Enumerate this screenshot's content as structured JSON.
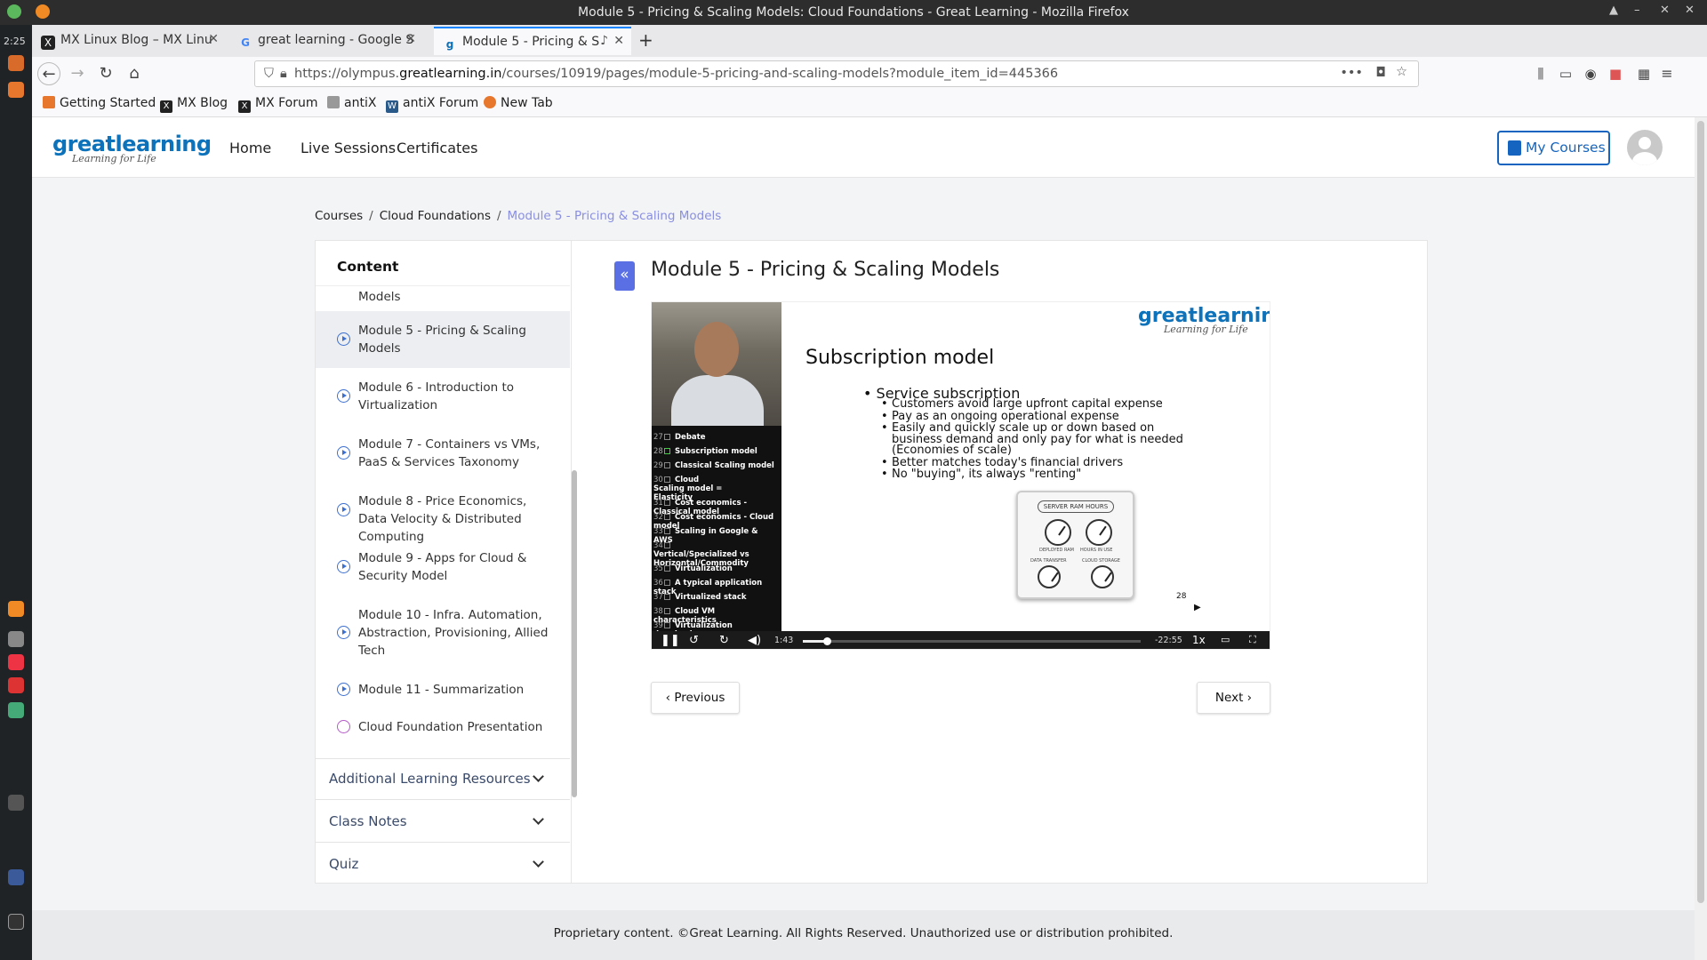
{
  "window": {
    "title": "Module 5 - Pricing & Scaling Models: Cloud Foundations - Great Learning - Mozilla Firefox"
  },
  "desktop": {
    "clock": "2:25"
  },
  "tabs": [
    {
      "label": "MX Linux Blog – MX Linu",
      "icon": "x-logo-icon"
    },
    {
      "label": "great learning - Google S",
      "icon": "google-icon"
    },
    {
      "label": "Module 5 - Pricing & S",
      "icon": "gl-icon",
      "active": true
    }
  ],
  "url": {
    "prefix": "https://olympus.",
    "domain": "greatlearning.in",
    "path": "/courses/10919/pages/module-5-pricing-and-scaling-models?module_item_id=445366"
  },
  "bookmarks": [
    "Getting Started",
    "MX Blog",
    "MX Forum",
    "antiX",
    "antiX Forum",
    "New Tab"
  ],
  "site": {
    "logo_main": "greatlearning",
    "logo_tag": "Learning for Life",
    "nav": [
      "Home",
      "Live Sessions",
      "Certificates"
    ],
    "my_courses": "My Courses"
  },
  "breadcrumb": [
    "Courses",
    "Cloud Foundations",
    "Module 5 - Pricing & Scaling Models"
  ],
  "sidebar": {
    "title": "Content",
    "items": [
      {
        "label": "Models"
      },
      {
        "label": "Module 5 - Pricing & Scaling Models",
        "active": true
      },
      {
        "label": "Module 6 - Introduction to Virtualization"
      },
      {
        "label": "Module 7 - Containers vs VMs, PaaS & Services Taxonomy"
      },
      {
        "label": "Module 8 - Price Economics, Data Velocity & Distributed Computing"
      },
      {
        "label": "Module 9 - Apps for Cloud & Security Model"
      },
      {
        "label": "Module 10 - Infra. Automation, Abstraction, Provisioning, Allied Tech"
      },
      {
        "label": "Module 11 - Summarization"
      },
      {
        "label": "Cloud Foundation Presentation"
      }
    ],
    "sections": [
      "Additional Learning Resources",
      "Class Notes",
      "Quiz"
    ]
  },
  "content": {
    "title": "Module 5 - Pricing & Scaling Models",
    "slide": {
      "logo_main": "greatlearning",
      "logo_tag": "Learning for Life",
      "title": "Subscription model",
      "bullet": "Service subscription",
      "subbullets": [
        "Customers avoid large upfront capital expense",
        "Pay as an ongoing operational expense",
        "Easily and quickly scale up or down based on business demand and only pay for what is needed (Economies of scale)",
        "Better matches today's financial drivers",
        "No \"buying\", its always \"renting\""
      ],
      "meter_label": "SERVER RAM HOURS",
      "gauge_labels": [
        "DEPLOYED RAM",
        "HOURS IN USE",
        "DATA TRANSFER",
        "CLOUD STORAGE"
      ],
      "page_number": "28"
    },
    "toc": [
      {
        "n": "27",
        "t": "Debate"
      },
      {
        "n": "28",
        "t": "Subscription model",
        "checked": true
      },
      {
        "n": "29",
        "t": "Classical Scaling model"
      },
      {
        "n": "30",
        "t": "Cloud Scaling model = Elasticity"
      },
      {
        "n": "31",
        "t": "Cost economics - Classical model"
      },
      {
        "n": "32",
        "t": "Cost economics - Cloud model"
      },
      {
        "n": "33",
        "t": "Scaling in Google & AWS"
      },
      {
        "n": "34",
        "t": "Vertical/Specialized vs Horizontal/Commodity"
      },
      {
        "n": "35",
        "t": "Virtualization"
      },
      {
        "n": "36",
        "t": "A typical application stack"
      },
      {
        "n": "37",
        "t": "Virtualized stack"
      },
      {
        "n": "38",
        "t": "Cloud VM characteristics"
      },
      {
        "n": "39",
        "t": "Virtualization drawbacks"
      }
    ],
    "player": {
      "elapsed": "1:43",
      "remaining": "-22:55",
      "speed": "1x",
      "progress": 0.07
    },
    "prev": "Previous",
    "next": "Next"
  },
  "footer": "Proprietary content. ©Great Learning. All Rights Reserved. Unauthorized use or distribution prohibited.",
  "colors": {
    "accent": "#5b6fe5",
    "brand": "#0d72b9",
    "link": "#1565c0"
  }
}
